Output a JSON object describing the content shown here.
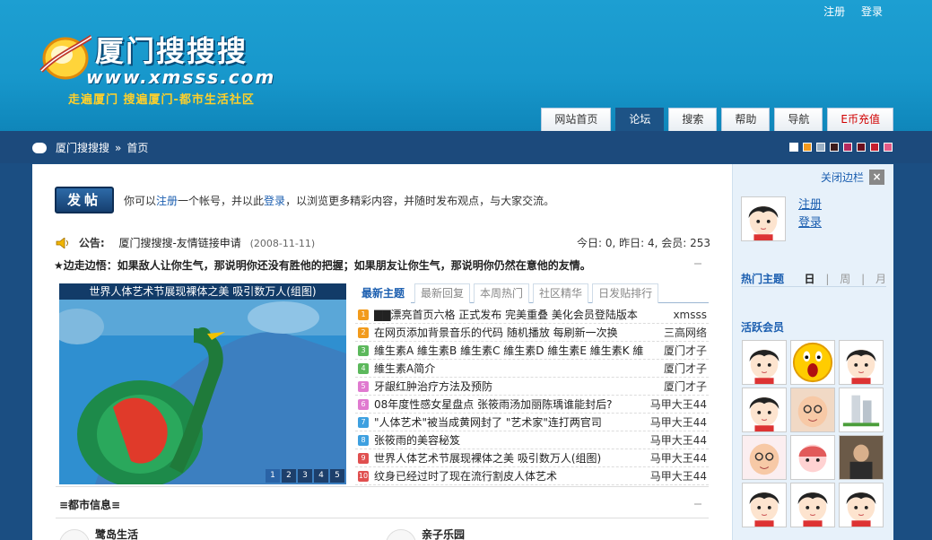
{
  "header": {
    "top_links": [
      "注册",
      "登录"
    ],
    "logo_title": "厦门搜搜搜",
    "logo_domain": "www.xmsss.com",
    "logo_slogan": "走遍厦门 搜遍厦门-都市生活社区",
    "nav": [
      "网站首页",
      "论坛",
      "搜索",
      "帮助",
      "导航",
      "E币充值"
    ]
  },
  "breadcrumb": {
    "site": "厦门搜搜搜",
    "sep": "»",
    "current": "首页"
  },
  "theme_swatches": [
    "#ffffff",
    "#f39a1e",
    "#9ab0c5",
    "#3b1a1a",
    "#b5295d",
    "#6b0f1e",
    "#c51f2f",
    "#e35a86"
  ],
  "welcome": {
    "button": "发帖",
    "pre": "你可以",
    "register": "注册",
    "mid": "一个帐号，并以此",
    "login": "登录",
    "post": "，以浏览更多精彩内容，并随时发布观点，与大家交流。"
  },
  "notice": {
    "label": "公告:",
    "link": "厦门搜搜搜-友情链接申请",
    "date": "(2008-11-11)",
    "stats": "今日: 0, 昨日: 4, 会员: 253"
  },
  "quote": "★边走边悟：如果敌人让你生气，那说明你还没有胜他的把握；如果朋友让你生气，那说明你仍然在意他的友情。",
  "slideshow": {
    "title": "世界人体艺术节展现裸体之美 吸引数万人(组图)",
    "pages": [
      "1",
      "2",
      "3",
      "4",
      "5"
    ]
  },
  "topic_tabs": [
    "最新主题",
    "最新回复",
    "本周热门",
    "社区精华",
    "日发贴排行"
  ],
  "topics": [
    {
      "title": "▇▇漂亮首页六格 正式发布 完美重叠 美化会员登陆版本",
      "author": "xmsss",
      "color": "#f29b1c"
    },
    {
      "title": "在网页添加背景音乐的代码 随机播放 每刷新一次换",
      "author": "三高网络",
      "color": "#f29b1c"
    },
    {
      "title": "維生素A 維生素B 維生素C 維生素D 維生素E 維生素K 維",
      "author": "厦门才子",
      "color": "#5cb85c"
    },
    {
      "title": "維生素A简介",
      "author": "厦门才子",
      "color": "#5cb85c"
    },
    {
      "title": "牙龈红肿治疗方法及预防",
      "author": "厦门才子",
      "color": "#e07ad0"
    },
    {
      "title": "08年度性感女星盘点 张筱雨汤加丽陈瑀谁能封后?",
      "author": "马甲大王44",
      "color": "#e07ad0"
    },
    {
      "title": "\"人体艺术\"被当成黄网封了 \"艺术家\"连打两官司",
      "author": "马甲大王44",
      "color": "#3ea0e0"
    },
    {
      "title": "张筱雨的美容秘笈",
      "author": "马甲大王44",
      "color": "#3ea0e0"
    },
    {
      "title": "世界人体艺术节展现裸体之美 吸引数万人(组图)",
      "author": "马甲大王44",
      "color": "#e05050"
    },
    {
      "title": "纹身已经过时了现在流行割皮人体艺术",
      "author": "马甲大王44",
      "color": "#e05050"
    }
  ],
  "city_info": "≡都市信息≡",
  "sub_sections": [
    "鹭岛生活",
    "亲子乐园"
  ],
  "sidebar": {
    "close_label": "关闭边栏",
    "links": [
      "注册",
      "登录"
    ],
    "hot_title": "热门主题",
    "hot_periods": [
      "日",
      "周",
      "月"
    ],
    "hot_sep": "|",
    "active_title": "活跃会员",
    "member_count": 12
  }
}
